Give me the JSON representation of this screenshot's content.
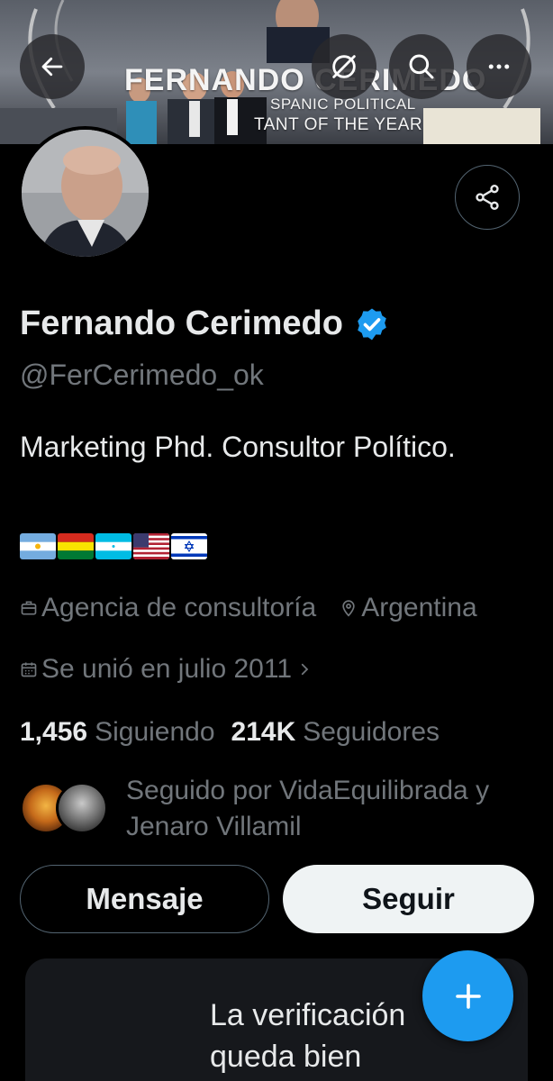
{
  "banner": {
    "line1": "FERNANDO CERIMEDO",
    "line2": "SPANIC POLITICAL",
    "line3": "TANT OF THE YEAR"
  },
  "header_buttons": [
    "back-icon",
    "grok-icon",
    "search-icon",
    "more-icon"
  ],
  "profile": {
    "name": "Fernando Cerimedo",
    "handle": "@FerCerimedo_ok",
    "bio": "Marketing Phd. Consultor Político.",
    "flags": [
      "Argentina",
      "Bolivia",
      "Honduras",
      "United States",
      "Israel"
    ],
    "category": "Agencia de consultoría",
    "location": "Argentina",
    "joined": "Se unió en julio 2011",
    "following_count": "1,456",
    "following_label": "Siguiendo",
    "followers_count": "214K",
    "followers_label": "Seguidores",
    "followed_by": "Seguido por VidaEquilibrada y Jenaro Villamil"
  },
  "actions": {
    "message": "Mensaje",
    "follow": "Seguir"
  },
  "promo": {
    "line1": "La verificación",
    "line2": "queda bien"
  },
  "colors": {
    "accent": "#1d9bf0",
    "background": "#000000",
    "text_secondary": "#71767b"
  }
}
